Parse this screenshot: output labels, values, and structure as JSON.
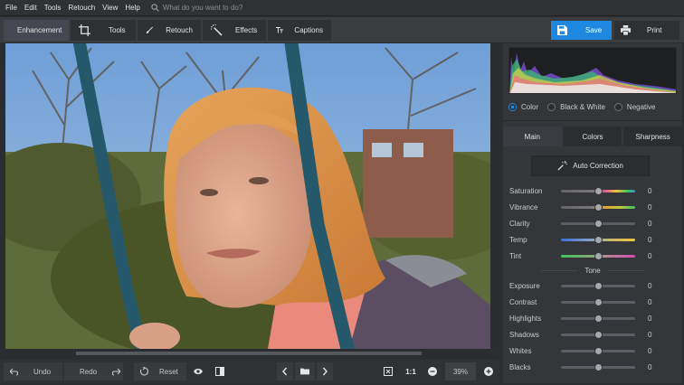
{
  "menu": [
    "File",
    "Edit",
    "Tools",
    "Retouch",
    "View",
    "Help"
  ],
  "search": {
    "placeholder": "What do you want to do?"
  },
  "tabs": [
    {
      "label": "Enhancement",
      "icon": "sliders-icon"
    },
    {
      "label": "Tools",
      "icon": "crop-icon"
    },
    {
      "label": "Retouch",
      "icon": "brush-icon"
    },
    {
      "label": "Effects",
      "icon": "magic-wand-icon"
    },
    {
      "label": "Captions",
      "icon": "text-icon"
    }
  ],
  "actions": {
    "save": "Save",
    "print": "Print"
  },
  "bottom": {
    "undo": "Undo",
    "redo": "Redo",
    "reset": "Reset",
    "one_to_one": "1:1",
    "zoom": "39%"
  },
  "modes": [
    {
      "label": "Color",
      "selected": true
    },
    {
      "label": "Black & White",
      "selected": false
    },
    {
      "label": "Negative",
      "selected": false
    }
  ],
  "panel_tabs": [
    "Main",
    "Colors",
    "Sharpness"
  ],
  "auto_correction": "Auto Correction",
  "sliders_main": [
    {
      "label": "Saturation",
      "value": "0",
      "gradient": "sat"
    },
    {
      "label": "Vibrance",
      "value": "0",
      "gradient": "vib"
    },
    {
      "label": "Clarity",
      "value": "0",
      "gradient": "gray"
    },
    {
      "label": "Temp",
      "value": "0",
      "gradient": "temp"
    },
    {
      "label": "Tint",
      "value": "0",
      "gradient": "tint"
    }
  ],
  "tone_label": "Tone",
  "sliders_tone": [
    {
      "label": "Exposure",
      "value": "0"
    },
    {
      "label": "Contrast",
      "value": "0"
    },
    {
      "label": "Highlights",
      "value": "0"
    },
    {
      "label": "Shadows",
      "value": "0"
    },
    {
      "label": "Whites",
      "value": "0"
    },
    {
      "label": "Blacks",
      "value": "0"
    }
  ],
  "colors": {
    "accent": "#1e88e0",
    "panel": "#34363a",
    "toolbar": "#3a3c40"
  }
}
